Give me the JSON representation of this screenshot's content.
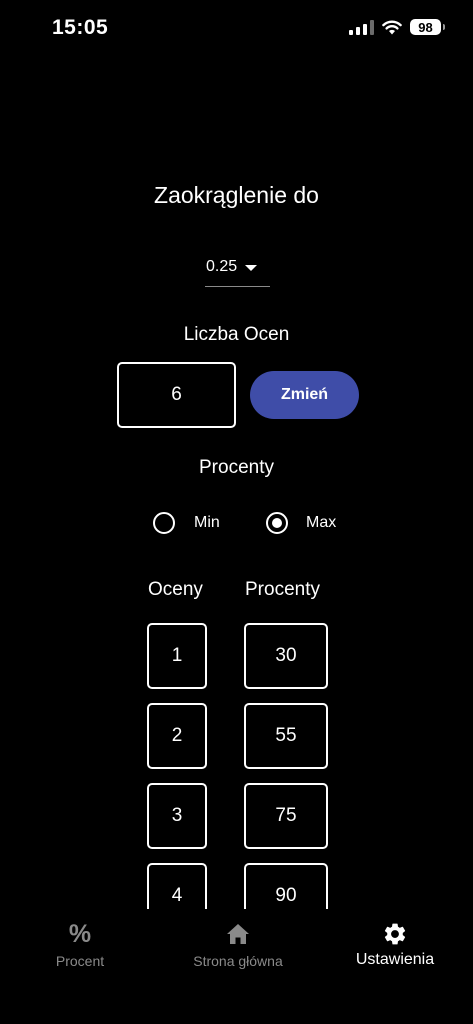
{
  "status_bar": {
    "time": "15:05",
    "battery": "98"
  },
  "settings": {
    "rounding_title": "Zaokrąglenie do",
    "rounding_value": "0.25",
    "grades_count_label": "Liczba Ocen",
    "grades_count_value": "6",
    "change_button": "Zmień",
    "percent_mode_label": "Procenty",
    "percent_mode_options": [
      {
        "label": "Min",
        "selected": false
      },
      {
        "label": "Max",
        "selected": true
      }
    ],
    "table_headers": {
      "grades": "Oceny",
      "percents": "Procenty"
    },
    "rows": [
      {
        "grade": "1",
        "percent": "30"
      },
      {
        "grade": "2",
        "percent": "55"
      },
      {
        "grade": "3",
        "percent": "75"
      },
      {
        "grade": "4",
        "percent": "90"
      }
    ]
  },
  "bottom_nav": {
    "items": [
      {
        "label": "Procent",
        "icon": "percent-icon",
        "active": false
      },
      {
        "label": "Strona główna",
        "icon": "home-icon",
        "active": false
      },
      {
        "label": "Ustawienia",
        "icon": "gear-icon",
        "active": true
      }
    ]
  },
  "colors": {
    "background": "#000000",
    "accent": "#3f4da8",
    "inactive": "#8a8a8a"
  }
}
